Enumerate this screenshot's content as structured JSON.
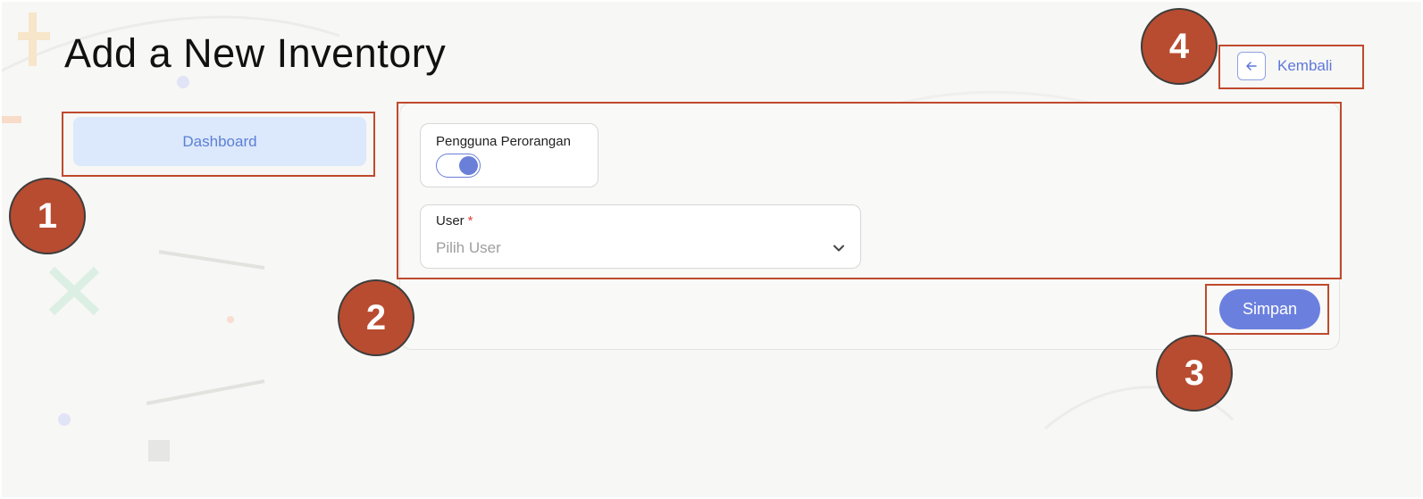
{
  "page": {
    "title": "Add a New Inventory"
  },
  "sidebar": {
    "items": [
      {
        "label": "Dashboard"
      }
    ]
  },
  "form": {
    "toggle": {
      "label": "Pengguna Perorangan",
      "checked": true
    },
    "user_select": {
      "label": "User",
      "required_mark": "*",
      "placeholder": "Pilih User"
    },
    "save_label": "Simpan"
  },
  "header": {
    "back_label": "Kembali"
  },
  "annotations": [
    {
      "label": "1"
    },
    {
      "label": "2"
    },
    {
      "label": "3"
    },
    {
      "label": "4"
    }
  ],
  "icons": {
    "back": "arrow-left-icon",
    "dropdown": "chevron-down-icon"
  },
  "colors": {
    "accent": "#6b80de",
    "sidebar_active_bg": "#dce8fb",
    "annotation": "#b84c30",
    "required": "#e0413a"
  }
}
